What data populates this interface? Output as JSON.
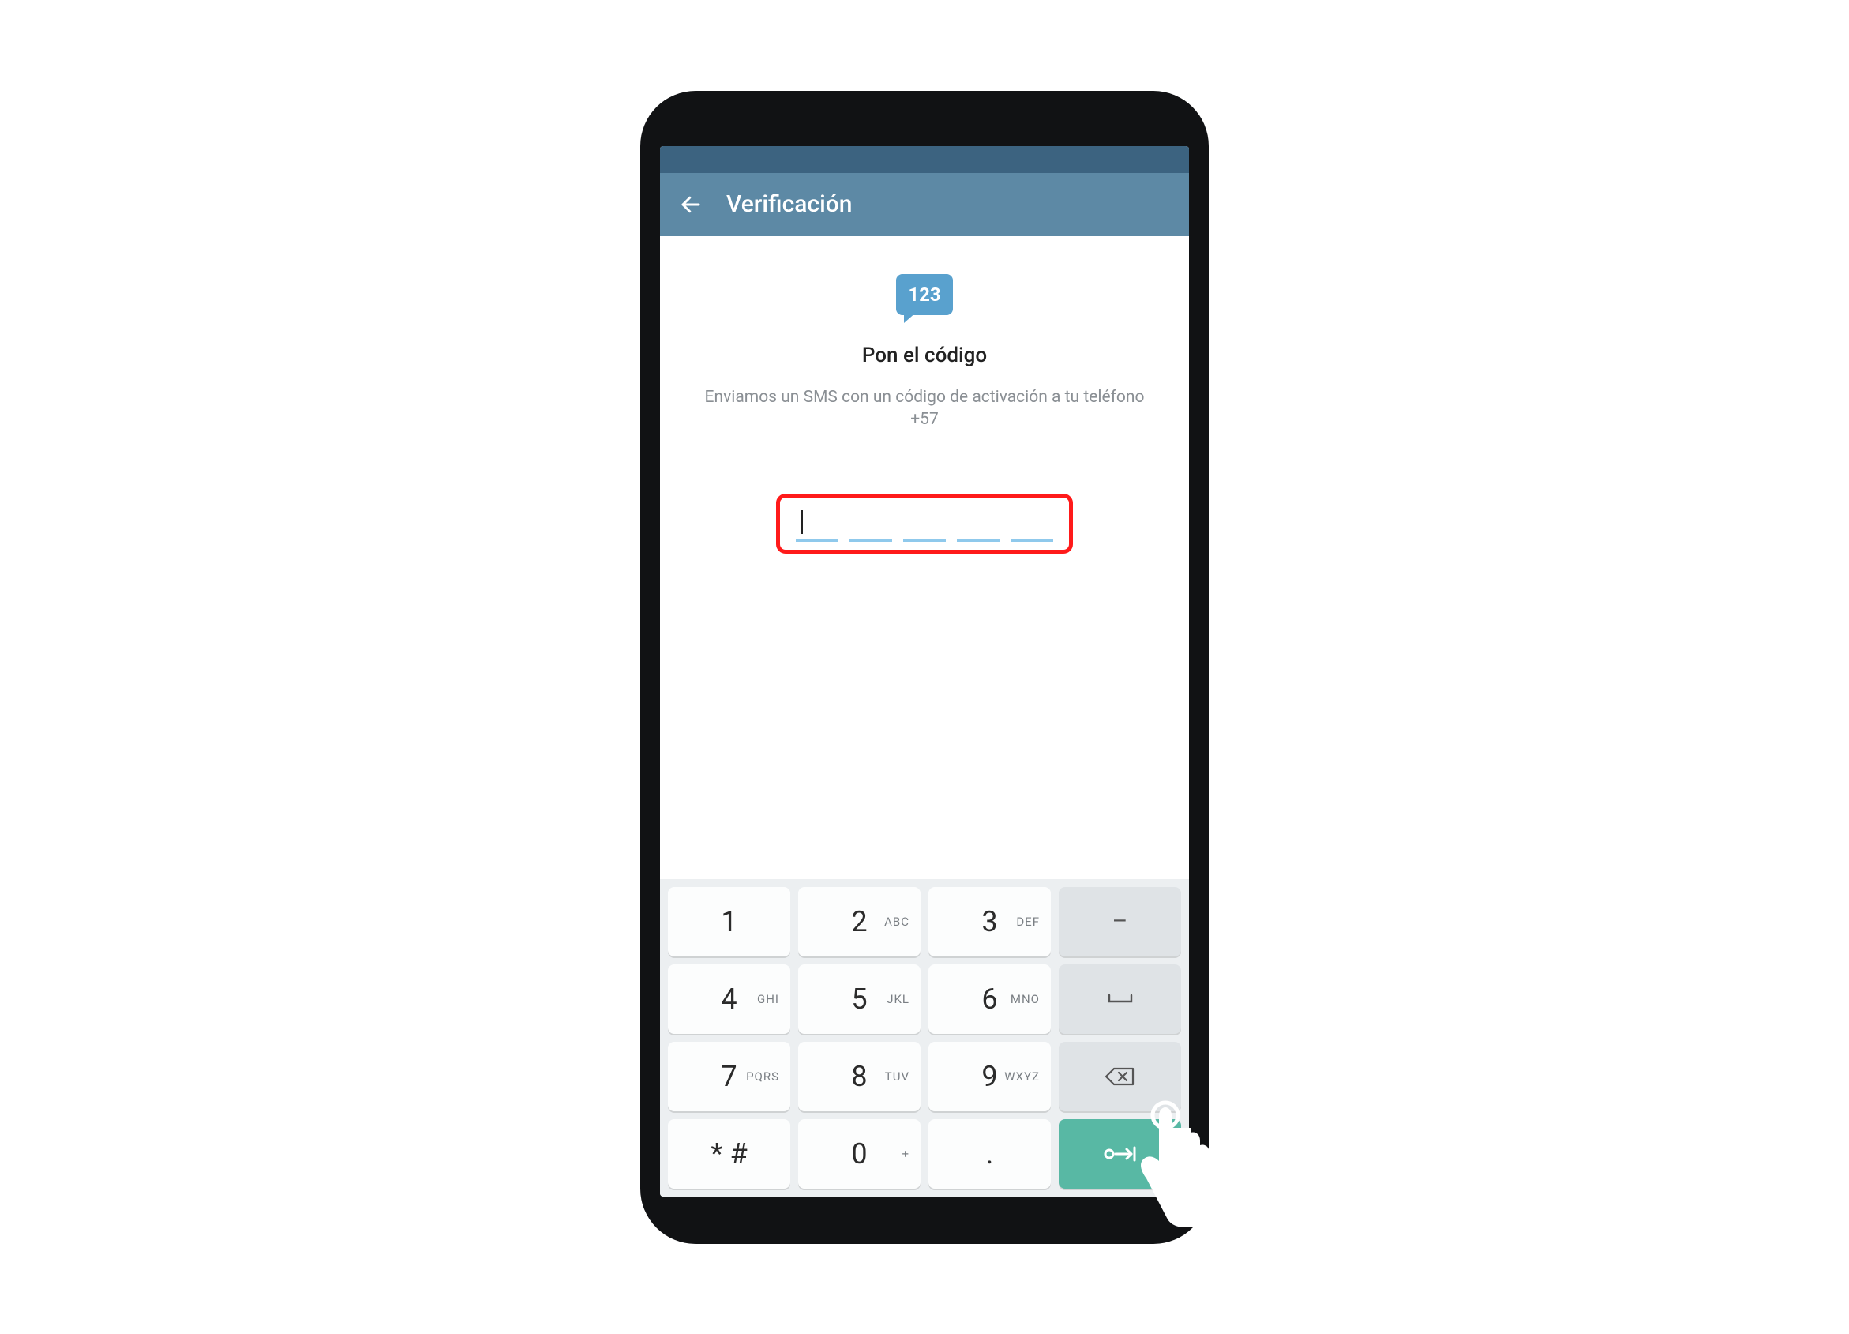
{
  "header": {
    "title": "Verificación"
  },
  "sms_icon_text": "123",
  "heading": "Pon el código",
  "subtext": "Enviamos un SMS con un código de activación a tu teléfono +57",
  "code_slots": 5,
  "keyboard": {
    "rows": [
      [
        {
          "main": "1",
          "sub": ""
        },
        {
          "main": "2",
          "sub": "ABC"
        },
        {
          "main": "3",
          "sub": "DEF"
        },
        {
          "main": "–",
          "sub": "",
          "fn": true
        }
      ],
      [
        {
          "main": "4",
          "sub": "GHI"
        },
        {
          "main": "5",
          "sub": "JKL"
        },
        {
          "main": "6",
          "sub": "MNO"
        },
        {
          "main": "␣",
          "sub": "",
          "fn": true,
          "icon": "space"
        }
      ],
      [
        {
          "main": "7",
          "sub": "PQRS"
        },
        {
          "main": "8",
          "sub": "TUV"
        },
        {
          "main": "9",
          "sub": "WXYZ"
        },
        {
          "main": "⌫",
          "sub": "",
          "fn": true,
          "icon": "backspace"
        }
      ],
      [
        {
          "main": "* #",
          "sub": ""
        },
        {
          "main": "0",
          "sub": "+"
        },
        {
          "main": ".",
          "sub": ""
        },
        {
          "main": "",
          "sub": "",
          "fn": true,
          "enter": true,
          "icon": "enter"
        }
      ]
    ]
  },
  "colors": {
    "appbar": "#5d89a5",
    "statusbar": "#3c6380",
    "icon": "#59a1ce",
    "highlight": "#ff1a1a",
    "enter": "#58b8a4"
  }
}
